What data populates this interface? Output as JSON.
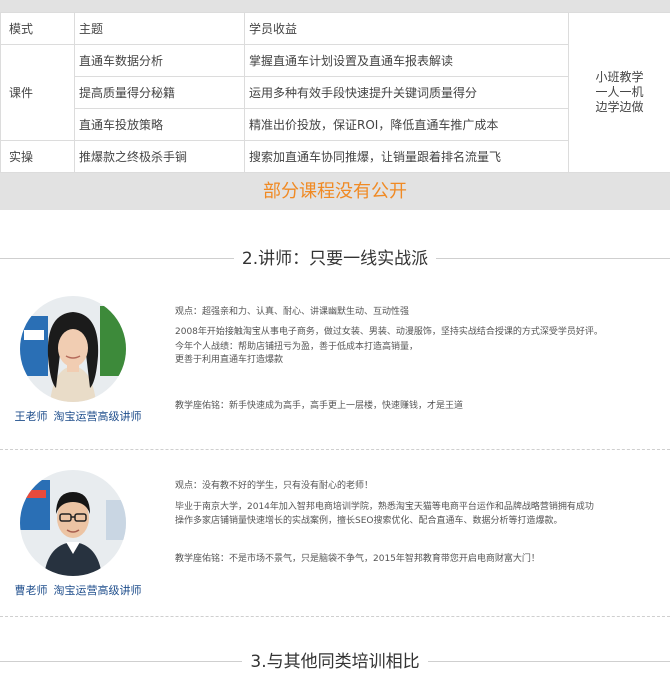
{
  "table": {
    "header": {
      "mode": "模式",
      "topic": "主题",
      "benefit": "学员收益"
    },
    "side_note": [
      "小班教学",
      "一人一机",
      "边学边做"
    ],
    "rows": [
      {
        "mode": "课件",
        "topic": "直通车数据分析",
        "benefit": "掌握直通车计划设置及直通车报表解读"
      },
      {
        "mode": "",
        "topic": "提高质量得分秘籍",
        "benefit": "运用多种有效手段快速提升关键词质量得分"
      },
      {
        "mode": "",
        "topic": "直通车投放策略",
        "benefit": "精准出价投放，保证ROI，降低直通车推广成本"
      },
      {
        "mode": "实操",
        "topic": "推爆款之终极杀手锏",
        "benefit": "搜索加直通车协同推爆，让销量跟着排名流量飞"
      }
    ]
  },
  "banner": "部分课程没有公开",
  "section2_title": "2.讲师：只要一线实战派",
  "teachers": [
    {
      "name": "王老师",
      "title": "淘宝运营高级讲师",
      "viewpoint": "观点：超强亲和力、认真、耐心、讲课幽默生动、互动性强",
      "bio": [
        "2008年开始接触淘宝从事电子商务，做过女装、男装、动漫服饰，坚持实战结合授课的方式深受学员好评。",
        "今年个人战绩：帮助店铺扭亏为盈，善于低成本打造高销量，",
        "更善于利用直通车打造爆款"
      ],
      "motto": "教学座佑铭：新手快速成为高手，高手更上一层楼，快速赚钱，才是王道"
    },
    {
      "name": "曹老师",
      "title": "淘宝运营高级讲师",
      "viewpoint": "观点：没有教不好的学生，只有没有耐心的老师！",
      "bio": [
        "毕业于南京大学，2014年加入智邦电商培训学院，熟悉淘宝天猫等电商平台运作和品牌战略营销拥有成功",
        "操作多家店铺销量快速增长的实战案例，擅长SEO搜索优化、配合直通车、数据分析等打造爆款。"
      ],
      "motto": "教学座佑铭：不是市场不景气，只是脑袋不争气，2015年智邦教育带您开启电商财富大门！"
    }
  ],
  "section3_title": "3.与其他同类培训相比",
  "colors": {
    "accent": "#f08a24",
    "name_blue": "#1f4e8c"
  }
}
